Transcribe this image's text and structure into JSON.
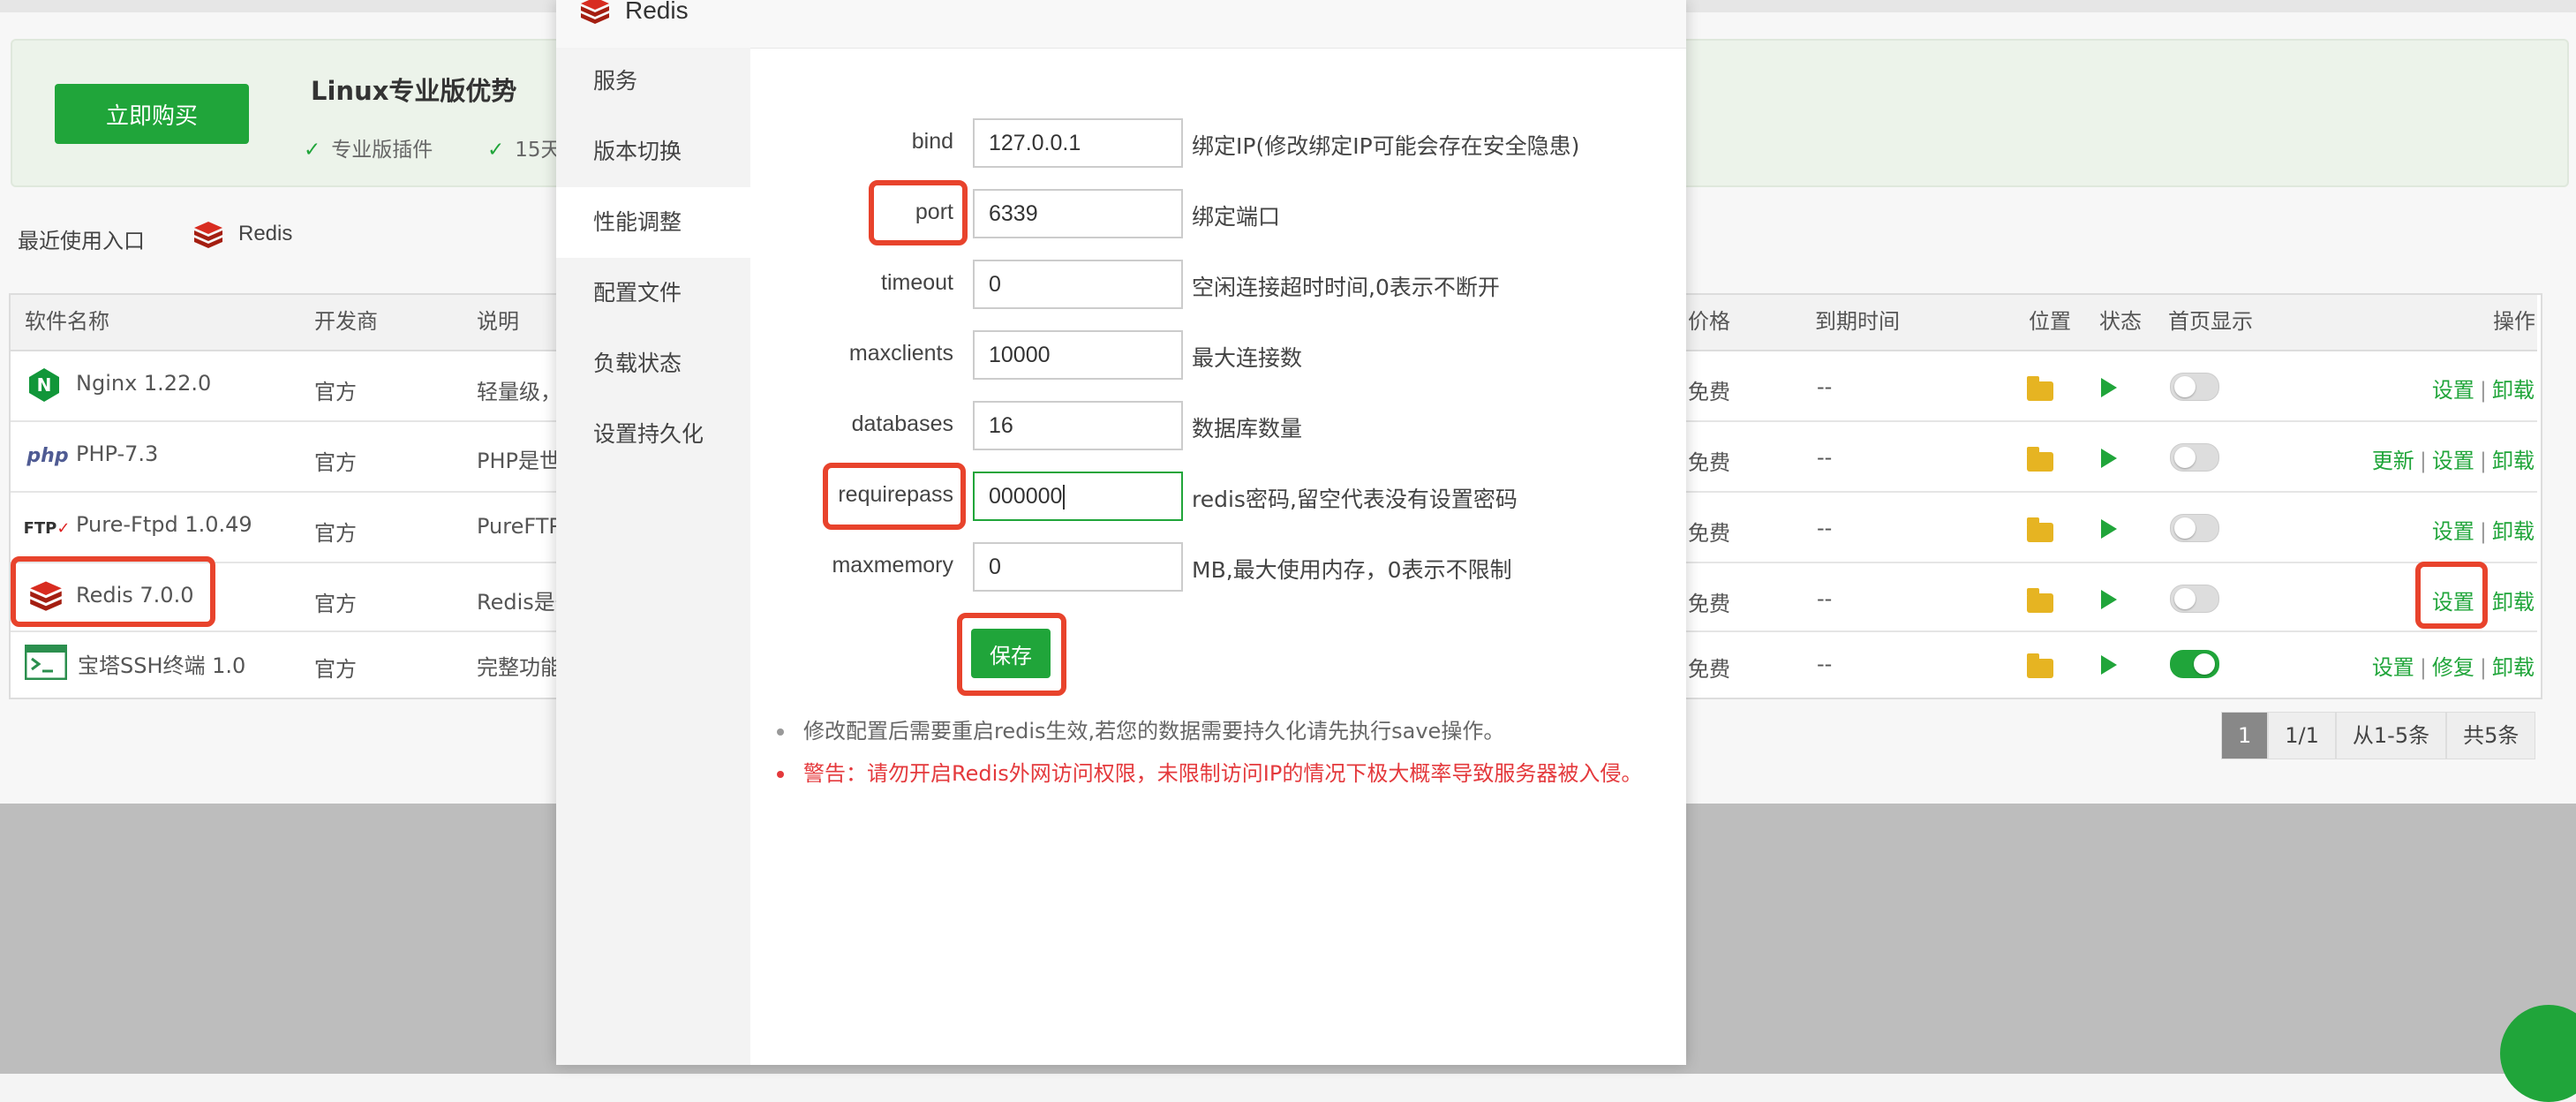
{
  "background": {
    "promo": {
      "buy_label": "立即购买",
      "title": "Linux专业版优势",
      "features": [
        "专业版插件",
        "15天"
      ]
    },
    "recent": {
      "label": "最近使用入口",
      "item": "Redis"
    },
    "table": {
      "headers": {
        "name": "软件名称",
        "vendor": "开发商",
        "desc": "说明",
        "price": "价格",
        "expire": "到期时间",
        "location": "位置",
        "status": "状态",
        "homepage": "首页显示",
        "ops": "操作"
      },
      "rows": [
        {
          "name": "Nginx 1.22.0",
          "vendor": "官方",
          "desc": "轻量级，",
          "price": "免费",
          "expire": "--",
          "icon": "nginx-icon",
          "homepage_on": false,
          "ops": [
            "设置",
            "卸载"
          ]
        },
        {
          "name": "PHP-7.3",
          "vendor": "官方",
          "desc": "PHP是世",
          "price": "免费",
          "expire": "--",
          "icon": "php-icon",
          "homepage_on": false,
          "ops": [
            "更新",
            "设置",
            "卸载"
          ]
        },
        {
          "name": "Pure-Ftpd 1.0.49",
          "vendor": "官方",
          "desc": "PureFTP",
          "price": "免费",
          "expire": "--",
          "icon": "ftp-icon",
          "homepage_on": false,
          "ops": [
            "设置",
            "卸载"
          ]
        },
        {
          "name": "Redis 7.0.0",
          "vendor": "官方",
          "desc": "Redis是一",
          "price": "免费",
          "expire": "--",
          "icon": "redis-icon",
          "homepage_on": false,
          "ops": [
            "设置",
            "卸载"
          ]
        },
        {
          "name": "宝塔SSH终端 1.0",
          "vendor": "官方",
          "desc": "完整功能",
          "price": "免费",
          "expire": "--",
          "icon": "terminal-icon",
          "homepage_on": true,
          "ops": [
            "设置",
            "修复",
            "卸载"
          ]
        }
      ]
    },
    "pager": {
      "current": "1",
      "pages": "1/1",
      "range": "从1-5条",
      "total": "共5条"
    }
  },
  "modal": {
    "title": "Redis",
    "sidebar": [
      {
        "label": "服务",
        "active": false
      },
      {
        "label": "版本切换",
        "active": false
      },
      {
        "label": "性能调整",
        "active": true
      },
      {
        "label": "配置文件",
        "active": false
      },
      {
        "label": "负载状态",
        "active": false
      },
      {
        "label": "设置持久化",
        "active": false
      }
    ],
    "fields": [
      {
        "label": "bind",
        "value": "127.0.0.1",
        "desc": "绑定IP(修改绑定IP可能会存在安全隐患)"
      },
      {
        "label": "port",
        "value": "6339",
        "desc": "绑定端口"
      },
      {
        "label": "timeout",
        "value": "0",
        "desc": "空闲连接超时时间,0表示不断开"
      },
      {
        "label": "maxclients",
        "value": "10000",
        "desc": "最大连接数"
      },
      {
        "label": "databases",
        "value": "16",
        "desc": "数据库数量"
      },
      {
        "label": "requirepass",
        "value": "000000",
        "desc": "redis密码,留空代表没有设置密码"
      },
      {
        "label": "maxmemory",
        "value": "0",
        "desc": "MB,最大使用内存，0表示不限制"
      }
    ],
    "save_label": "保存",
    "notes": [
      "修改配置后需要重启redis生效,若您的数据需要持久化请先执行save操作。",
      "警告：请勿开启Redis外网访问权限，未限制访问IP的情况下极大概率导致服务器被入侵。"
    ]
  },
  "colors": {
    "accent": "#20a53a",
    "highlight": "#e8432c",
    "warning": "#e4393c"
  }
}
